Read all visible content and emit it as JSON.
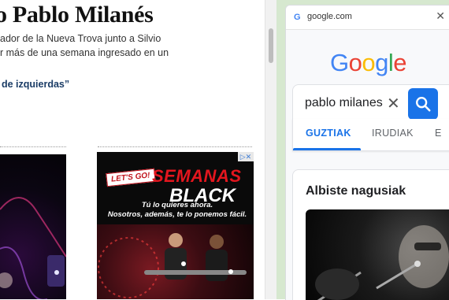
{
  "article": {
    "headline": "o Pablo Milanés",
    "lede_lines": [
      "ador de la Nueva Trova junto a Silvio",
      "r más de una semana ingresado en un"
    ],
    "related_link": "de izquierdas”"
  },
  "ad": {
    "tag": "LET'S GO!",
    "title_line1": "SEMANAS",
    "title_line2": "BLACK",
    "slogan_line1": "Tú lo quieres ahora.",
    "slogan_line2": "Nosotros, además, te lo ponemos fácil.",
    "choices_glyph": "▷✕"
  },
  "side_panel": {
    "url": "google.com",
    "close_glyph": "✕",
    "favicon": "G",
    "logo_letters": [
      {
        "char": "G",
        "color": "#4285F4"
      },
      {
        "char": "o",
        "color": "#EA4335"
      },
      {
        "char": "o",
        "color": "#FBBC05"
      },
      {
        "char": "g",
        "color": "#4285F4"
      },
      {
        "char": "l",
        "color": "#34A853"
      },
      {
        "char": "e",
        "color": "#EA4335"
      }
    ],
    "search": {
      "value": "pablo milanes",
      "clear_glyph": "✕",
      "button_icon": "search-icon"
    },
    "tabs": [
      "GUZTIAK",
      "IRUDIAK",
      "E"
    ],
    "active_tab": "GUZTIAK",
    "news_section_title": "Albiste nagusiak"
  },
  "colors": {
    "accent_blue": "#1A73E8",
    "panel_bg": "#D6E8CF",
    "link_color": "#1A3C66"
  }
}
